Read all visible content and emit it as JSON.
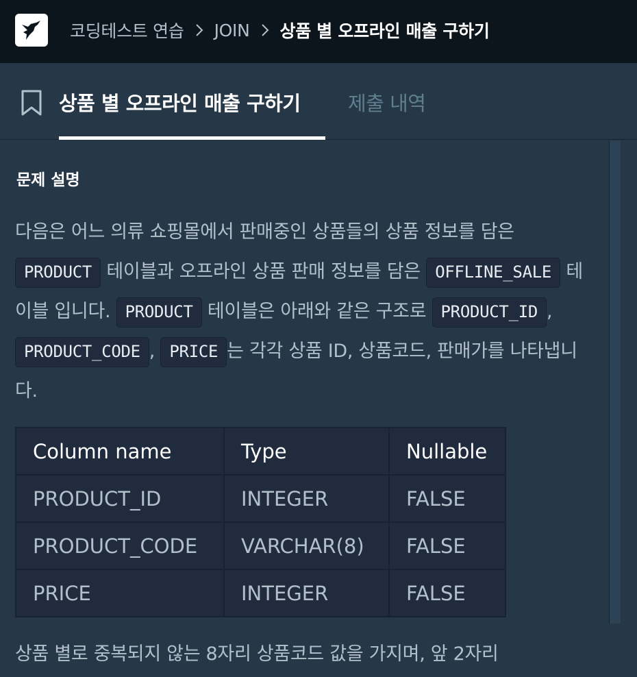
{
  "header": {
    "breadcrumbs": [
      "코딩테스트 연습",
      "JOIN"
    ],
    "current": "상품 별 오프라인 매출 구하기"
  },
  "tabs": {
    "active": "상품 별 오프라인 매출 구하기",
    "inactive": "제출 내역"
  },
  "problem": {
    "section_title": "문제 설명",
    "p1": {
      "t1": "다음은 어느 의류 쇼핑몰에서 판매중인 상품들의 상품 정보를 담은",
      "c1": "PRODUCT",
      "t2": "테이블과 오프라인 상품 판매 정보를 담은",
      "c2": "OFFLINE_SALE",
      "t3": "테이블 입니다.",
      "c3": "PRODUCT",
      "t4": "테이블은 아래와 같은 구조로",
      "c4": "PRODUCT_ID",
      "t5": ",",
      "c5": "PRODUCT_CODE",
      "t6": ",",
      "c6": "PRICE",
      "t7": "는 각각 상품 ID, 상품코드, 판매가를 나타냅니다."
    },
    "table": {
      "headers": [
        "Column name",
        "Type",
        "Nullable"
      ],
      "rows": [
        [
          "PRODUCT_ID",
          "INTEGER",
          "FALSE"
        ],
        [
          "PRODUCT_CODE",
          "VARCHAR(8)",
          "FALSE"
        ],
        [
          "PRICE",
          "INTEGER",
          "FALSE"
        ]
      ]
    },
    "p2": "상품 별로 중복되지 않는 8자리 상품코드 값을 가지며, 앞 2자리"
  }
}
